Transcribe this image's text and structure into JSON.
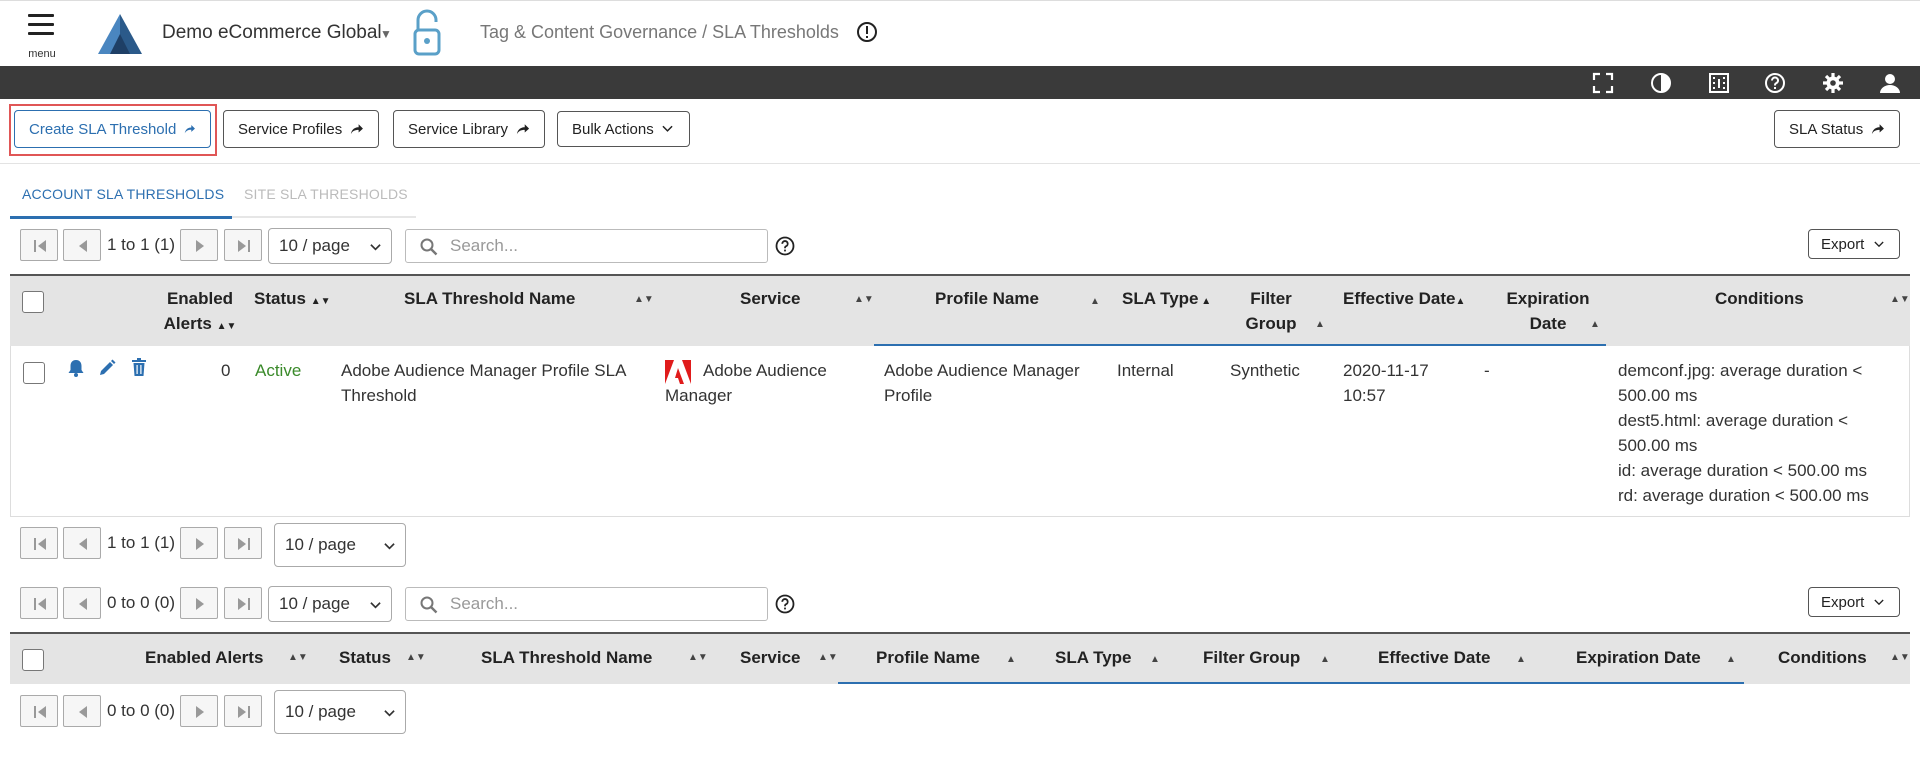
{
  "header": {
    "menu_label": "menu",
    "account_name": "Demo eCommerce Global",
    "breadcrumb": "Tag & Content Governance / SLA Thresholds"
  },
  "toolbar_icons": [
    "fullscreen-icon",
    "contrast-icon",
    "video-icon",
    "help-icon",
    "settings-icon",
    "user-icon"
  ],
  "actions": {
    "create": "Create SLA Threshold",
    "profiles": "Service Profiles",
    "library": "Service Library",
    "bulk": "Bulk Actions",
    "status": "SLA Status"
  },
  "tabs": {
    "account": "ACCOUNT SLA THRESHOLDS",
    "site": "SITE SLA THRESHOLDS"
  },
  "table1": {
    "pager_top": {
      "range": "1 to 1 (1)",
      "page_size": "10 / page"
    },
    "search_placeholder": "Search...",
    "export": "Export",
    "headers": {
      "enabled": "Enabled",
      "alerts": "Alerts",
      "status": "Status",
      "name": "SLA Threshold Name",
      "service": "Service",
      "profile": "Profile Name",
      "type": "SLA Type",
      "filter1": "Filter",
      "filter2": "Group",
      "effective": "Effective Date",
      "expiration1": "Expiration",
      "expiration2": "Date",
      "conditions": "Conditions"
    },
    "row": {
      "alerts": "0",
      "status": "Active",
      "name1": "Adobe Audience Manager Profile SLA",
      "name2": "Threshold",
      "service1": "Adobe Audience",
      "service2": "Manager",
      "profile1": "Adobe Audience Manager",
      "profile2": "Profile",
      "type": "Internal",
      "filter": "Synthetic",
      "effective1": "2020-11-17",
      "effective2": "10:57",
      "expiration": "-",
      "conditions": [
        "demconf.jpg: average duration <",
        "500.00 ms",
        "dest5.html: average duration <",
        "500.00 ms",
        "id: average duration < 500.00 ms",
        "rd: average duration < 500.00 ms"
      ]
    },
    "pager_bottom": {
      "range": "1 to 1 (1)",
      "page_size": "10 / page"
    }
  },
  "table2": {
    "pager_top": {
      "range": "0 to 0 (0)",
      "page_size": "10 / page"
    },
    "search_placeholder": "Search...",
    "export": "Export",
    "headers": {
      "enabled": "Enabled Alerts",
      "status": "Status",
      "name": "SLA Threshold Name",
      "service": "Service",
      "profile": "Profile Name",
      "type": "SLA Type",
      "filter": "Filter Group",
      "effective": "Effective Date",
      "expiration": "Expiration Date",
      "conditions": "Conditions"
    },
    "pager_bottom": {
      "range": "0 to 0 (0)",
      "page_size": "10 / page"
    }
  }
}
